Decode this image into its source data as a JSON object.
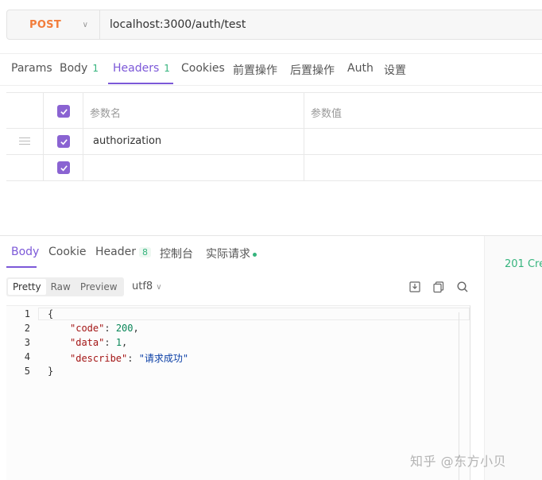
{
  "request": {
    "method": "POST",
    "url": "localhost:3000/auth/test"
  },
  "req_tabs": [
    {
      "label": "Params",
      "count": ""
    },
    {
      "label": "Body",
      "count": "1"
    },
    {
      "label": "Headers",
      "count": "1"
    },
    {
      "label": "Cookies",
      "count": ""
    },
    {
      "label": "前置操作",
      "count": ""
    },
    {
      "label": "后置操作",
      "count": ""
    },
    {
      "label": "Auth",
      "count": ""
    },
    {
      "label": "设置",
      "count": ""
    }
  ],
  "headers_table": {
    "col_name": "参数名",
    "col_value": "参数值",
    "rows": [
      {
        "name": "authorization",
        "value": "",
        "checked": true
      },
      {
        "name": "",
        "value": "",
        "checked": true
      }
    ]
  },
  "resp_tabs": [
    {
      "label": "Body",
      "count": ""
    },
    {
      "label": "Cookie",
      "count": ""
    },
    {
      "label": "Header",
      "count": "8"
    },
    {
      "label": "控制台",
      "count": ""
    },
    {
      "label": "实际请求",
      "count": ""
    }
  ],
  "format_buttons": [
    "Pretty",
    "Raw",
    "Preview"
  ],
  "encoding": "utf8",
  "status_text": "201 Cre",
  "code": {
    "line_numbers": [
      "1",
      "2",
      "3",
      "4",
      "5"
    ],
    "open_brace": "{",
    "close_brace": "}",
    "key_code": "\"code\"",
    "val_code": "200",
    "key_data": "\"data\"",
    "val_data": "1",
    "key_describe": "\"describe\"",
    "val_describe": "\"请求成功\""
  },
  "watermark": "知乎 @东方小贝",
  "colors": {
    "accent": "#7c58d8",
    "method": "#f27d3b",
    "success": "#35b47d"
  },
  "icons": [
    "chevron-down-icon",
    "checkbox-checked-icon",
    "drag-handle-icon",
    "download-icon",
    "copy-icon",
    "search-icon"
  ]
}
